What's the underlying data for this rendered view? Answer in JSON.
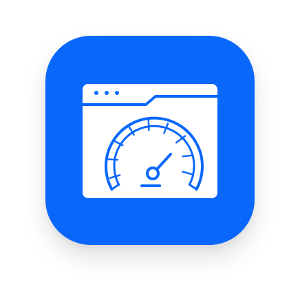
{
  "app_icon": {
    "icon": "browser-speedometer-icon",
    "colors": {
      "background": "#0a67fb",
      "glyph": "#ffffff"
    }
  }
}
